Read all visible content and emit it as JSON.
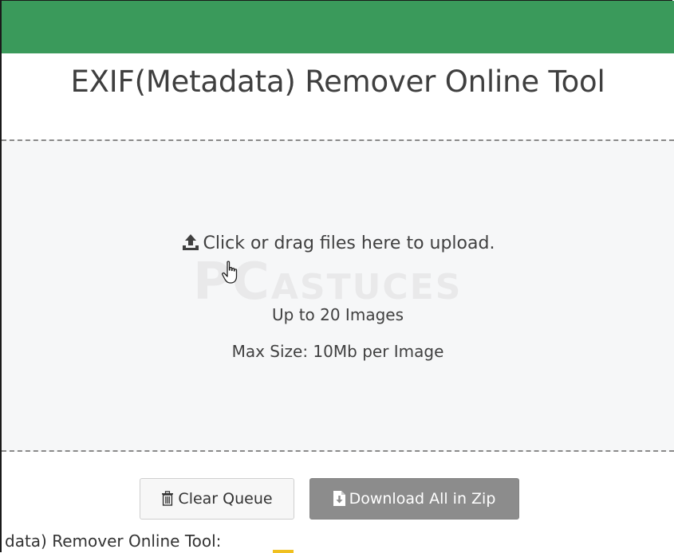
{
  "header": {
    "bar_color": "#3a9a5b",
    "title": "EXIF(Metadata) Remover Online Tool"
  },
  "dropzone": {
    "upload_icon": "upload-icon",
    "prompt": "Click or drag files here to upload.",
    "limit": "Up to 20 Images",
    "max_size": "Max Size: 10Mb per Image",
    "watermark": "PCASTUCES"
  },
  "actions": {
    "clear_label": "Clear Queue",
    "clear_icon": "trash-icon",
    "download_label": "Download All in Zip",
    "download_icon": "file-download-icon"
  },
  "footer": {
    "partial_heading": "data) Remover Online Tool:"
  }
}
